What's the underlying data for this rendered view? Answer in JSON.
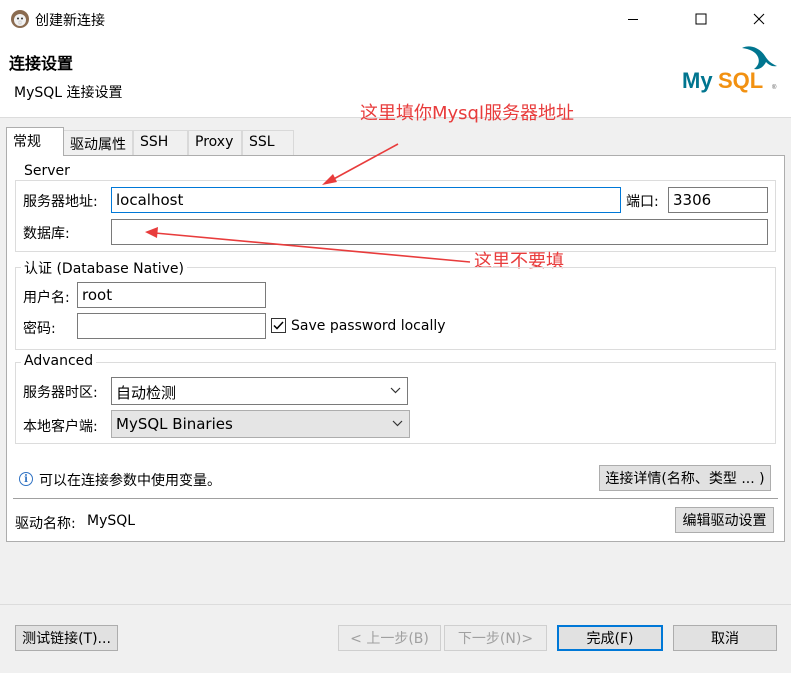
{
  "window": {
    "title": "创建新连接",
    "controls": [
      "minimize-icon",
      "maximize-icon",
      "close-icon"
    ]
  },
  "header": {
    "title": "连接设置",
    "subtitle": "MySQL 连接设置",
    "logo_text": "MySQL",
    "logo_colors": {
      "my": "#00758f",
      "sql": "#f29111"
    }
  },
  "tabs": [
    {
      "label": "常规",
      "active": true
    },
    {
      "label": "驱动属性"
    },
    {
      "label": "SSH"
    },
    {
      "label": "Proxy"
    },
    {
      "label": "SSL"
    }
  ],
  "server": {
    "group_title": "Server",
    "host_label": "服务器地址:",
    "host_value": "localhost",
    "port_label": "端口:",
    "port_value": "3306",
    "database_label": "数据库:",
    "database_value": ""
  },
  "auth": {
    "group_title": "认证 (Database Native)",
    "username_label": "用户名:",
    "username_value": "root",
    "password_label": "密码:",
    "password_value": "",
    "save_password_label": "Save password locally",
    "save_password_checked": true
  },
  "advanced": {
    "group_title": "Advanced",
    "timezone_label": "服务器时区:",
    "timezone_value": "自动检测",
    "client_label": "本地客户端:",
    "client_value": "MySQL Binaries"
  },
  "info": {
    "text": "可以在连接参数中使用变量。",
    "details_button": "连接详情(名称、类型 ... )"
  },
  "driver": {
    "label": "驱动名称:",
    "value": "MySQL",
    "edit_button": "编辑驱动设置"
  },
  "footer": {
    "test_button": "测试链接(T)...",
    "back_button": "< 上一步(B)",
    "next_button": "下一步(N)>",
    "finish_button": "完成(F)",
    "cancel_button": "取消"
  },
  "annotations": {
    "host_note": "这里填你Mysql服务器地址",
    "database_note": "这里不要填",
    "color": "#e83c3c"
  }
}
